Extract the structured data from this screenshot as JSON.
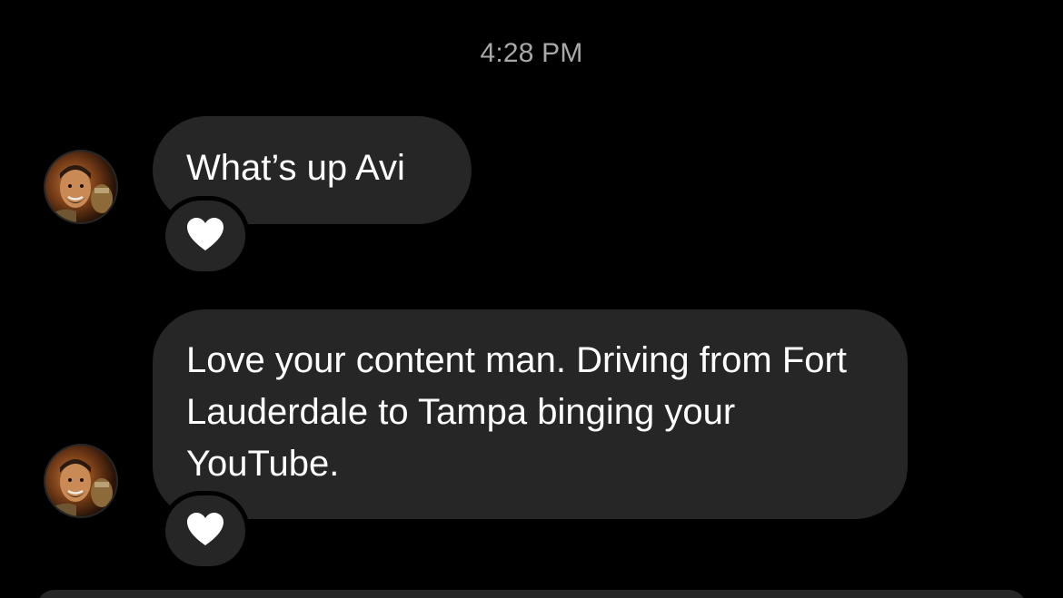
{
  "timestamp": "4:28 PM",
  "messages": [
    {
      "text": "What’s up Avi",
      "reaction_icon": "heart-icon"
    },
    {
      "text": "Love your content man. Driving from Fort Lauderdale to Tampa binging your YouTube.",
      "reaction_icon": "heart-icon"
    }
  ],
  "colors": {
    "background": "#000000",
    "bubble": "#262626",
    "timestamp_text": "#a8a8a8",
    "message_text": "#ffffff",
    "heart": "#ffffff"
  }
}
